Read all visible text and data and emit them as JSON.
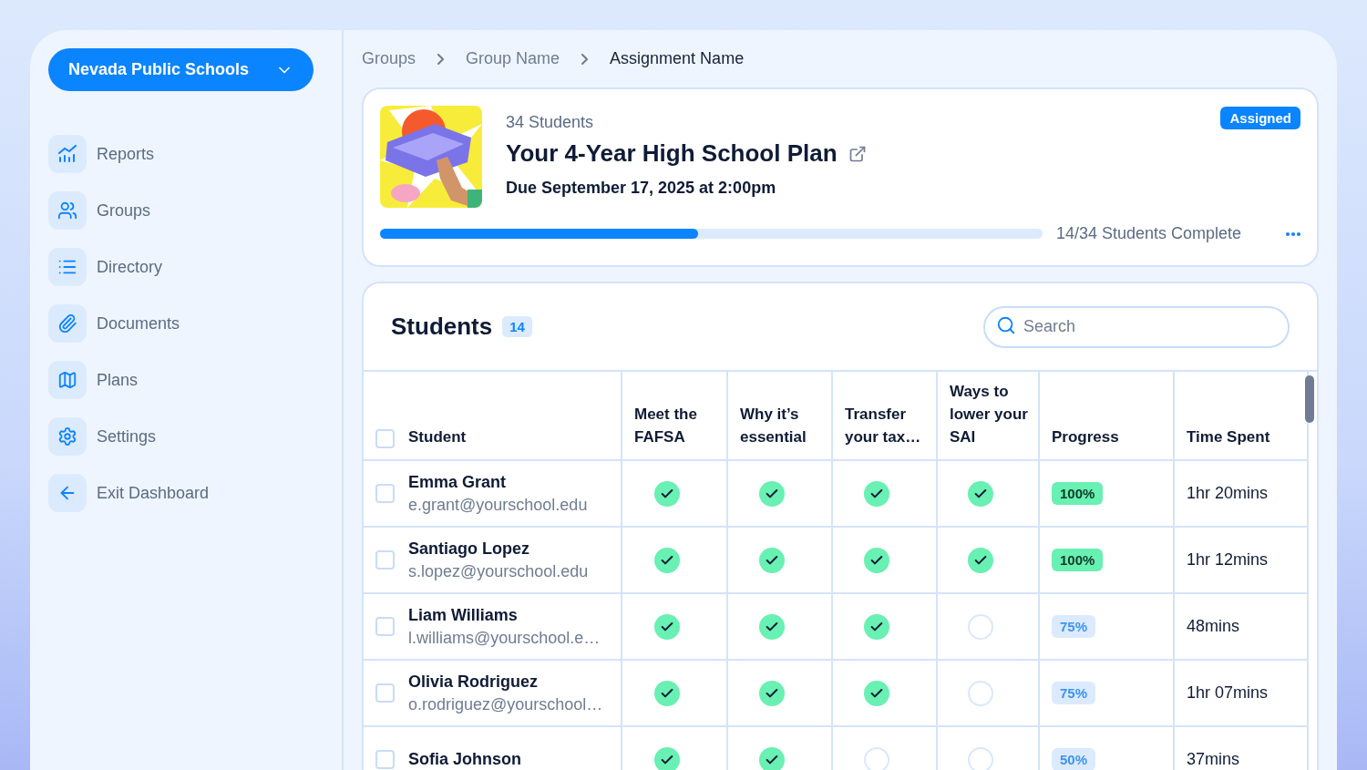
{
  "sidebar": {
    "org_selector": "Nevada Public Schools",
    "items": [
      {
        "label": "Reports"
      },
      {
        "label": "Groups"
      },
      {
        "label": "Directory"
      },
      {
        "label": "Documents"
      },
      {
        "label": "Plans"
      },
      {
        "label": "Settings"
      },
      {
        "label": "Exit Dashboard"
      }
    ]
  },
  "breadcrumb": [
    {
      "label": "Groups",
      "current": false
    },
    {
      "label": "Group Name",
      "current": false
    },
    {
      "label": "Assignment Name",
      "current": true
    }
  ],
  "assignment": {
    "count": "34 Students",
    "title": "Your 4-Year High School Plan",
    "due": "Due September 17, 2025 at 2:00pm",
    "status": "Assigned",
    "level": 0.48,
    "completion": "14/34 Students Complete"
  },
  "students": {
    "title": "Students",
    "count": "14",
    "search_placeholder": "Search",
    "columns": [
      "Student",
      "Meet the FAFSA",
      "Why it’s essential",
      "Transfer your tax…",
      "Ways to lower your SAI",
      "Progress",
      "Time Spent"
    ],
    "header_checked": false,
    "rows": [
      {
        "name": "Emma Grant",
        "email": "e.grant@yourschool.edu",
        "checked": false,
        "steps": [
          true,
          true,
          true,
          true
        ],
        "progress": "100%",
        "complete": true,
        "time": "1hr 20mins"
      },
      {
        "name": "Santiago Lopez",
        "email": "s.lopez@yourschool.edu",
        "checked": false,
        "steps": [
          true,
          true,
          true,
          true
        ],
        "progress": "100%",
        "complete": true,
        "time": "1hr 12mins"
      },
      {
        "name": "Liam Williams",
        "email": "l.williams@yourschool.e…",
        "checked": false,
        "steps": [
          true,
          true,
          true,
          false
        ],
        "progress": "75%",
        "complete": false,
        "time": "48mins"
      },
      {
        "name": "Olivia Rodriguez",
        "email": "o.rodriguez@yourschool…",
        "checked": false,
        "steps": [
          true,
          true,
          true,
          false
        ],
        "progress": "75%",
        "complete": false,
        "time": "1hr 07mins"
      },
      {
        "name": "Sofia Johnson",
        "checked": false,
        "steps": [
          true,
          true,
          false,
          false
        ],
        "progress": "50%",
        "complete": false,
        "time": "37mins"
      }
    ]
  }
}
